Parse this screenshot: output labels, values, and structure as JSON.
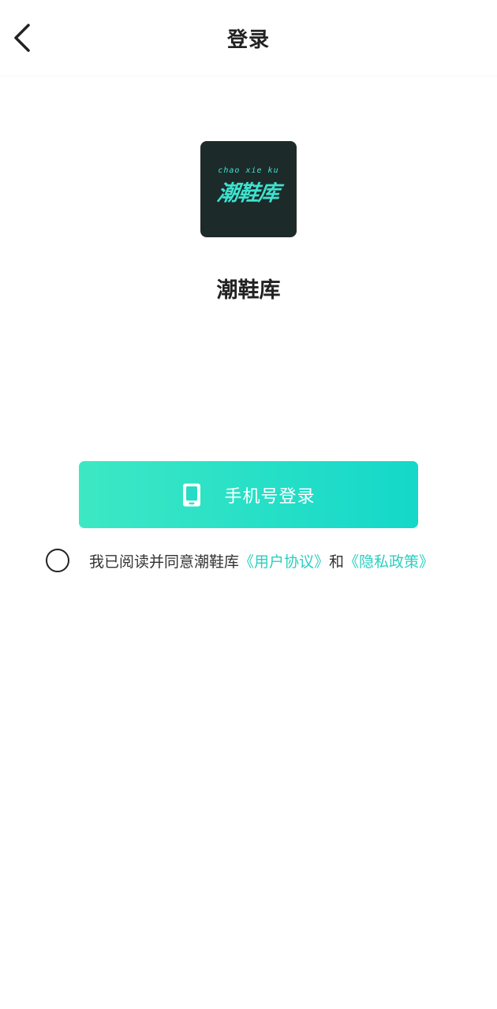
{
  "header": {
    "title": "登录",
    "back_icon": "chevron-left-icon"
  },
  "logo": {
    "subtitle": "chao xie ku",
    "mark": "潮鞋库",
    "background": "#1d2a2a",
    "accent": "#3de3cf"
  },
  "app_name": "潮鞋库",
  "login_button": {
    "label": "手机号登录",
    "icon": "phone-icon",
    "gradient_start": "#3de8c4",
    "gradient_end": "#14d8c9"
  },
  "agreement": {
    "checked": false,
    "prefix": "我已阅读并同意潮鞋库",
    "user_agreement": "《用户协议》",
    "conjunction": "和",
    "privacy_policy": "《隐私政策》",
    "link_color": "#2bcfc0"
  }
}
